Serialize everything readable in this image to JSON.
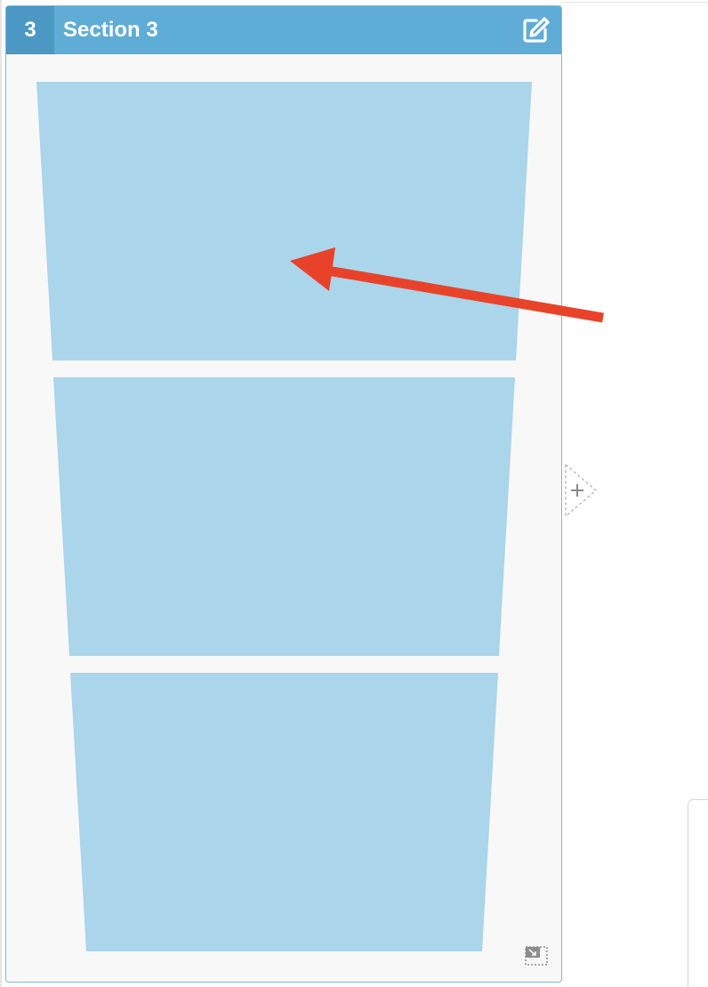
{
  "section": {
    "number": "3",
    "title": "Section 3"
  },
  "icons": {
    "edit": "edit-icon",
    "add": "plus-icon",
    "resize": "resize-icon",
    "annotation": "red-arrow"
  },
  "colors": {
    "header": "#5fadd6",
    "number_box": "#4b98c4",
    "card_fill": "#f8f8f8",
    "funnel_block": "#aad5ea",
    "annotation_arrow": "#e8432a"
  },
  "funnel": {
    "block_count": 3
  }
}
